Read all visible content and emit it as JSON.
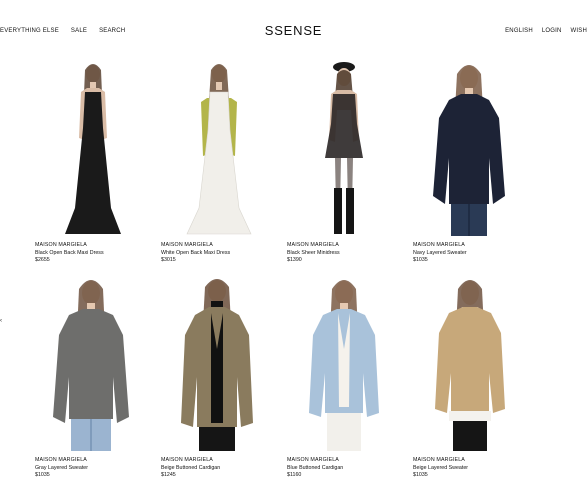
{
  "header": {
    "logo": "SSENSE",
    "nav_left": [
      "EVERYTHING ELSE",
      "SALE",
      "SEARCH"
    ],
    "nav_right": [
      "ENGLISH",
      "LOGIN",
      "WISH"
    ]
  },
  "carousel": {
    "left_arrow": "‹"
  },
  "products": [
    {
      "brand": "MAISON MARGIELA",
      "name": "Black Open Back Maxi Dress",
      "price": "$2655",
      "garment_color": "#1a1a1a",
      "icon": "black-dress-image"
    },
    {
      "brand": "MAISON MARGIELA",
      "name": "White Open Back Maxi Dress",
      "price": "$3015",
      "garment_color": "#f1efea",
      "icon": "white-dress-image"
    },
    {
      "brand": "MAISON MARGIELA",
      "name": "Black Sheer Minidress",
      "price": "$1390",
      "garment_color": "#2a2626",
      "icon": "black-minidress-image"
    },
    {
      "brand": "MAISON MARGIELA",
      "name": "Navy Layered Sweater",
      "price": "$1035",
      "garment_color": "#1d2336",
      "icon": "navy-sweater-image"
    },
    {
      "brand": "MAISON MARGIELA",
      "name": "Gray Layered Sweater",
      "price": "$1035",
      "garment_color": "#6e6e6c",
      "icon": "gray-sweater-image"
    },
    {
      "brand": "MAISON MARGIELA",
      "name": "Beige Buttoned Cardigan",
      "price": "$1245",
      "garment_color": "#8a7b5e",
      "icon": "beige-cardigan-image"
    },
    {
      "brand": "MAISON MARGIELA",
      "name": "Blue Buttoned Cardigan",
      "price": "$1160",
      "garment_color": "#a9c2da",
      "icon": "blue-cardigan-image"
    },
    {
      "brand": "MAISON MARGIELA",
      "name": "Beige Layered Sweater",
      "price": "$1035",
      "garment_color": "#c7a87a",
      "icon": "beige-sweater-image"
    }
  ]
}
